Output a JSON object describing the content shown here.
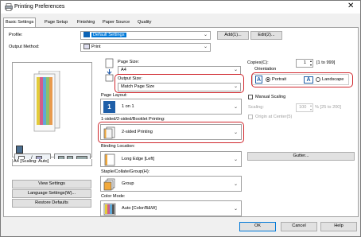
{
  "window": {
    "title": "Printing Preferences",
    "close_glyph": "✕"
  },
  "tabs": [
    "Basic Settings",
    "Page Setup",
    "Finishing",
    "Paper Source",
    "Quality"
  ],
  "profile": {
    "label": "Profile:",
    "value": "Default Settings",
    "add_btn": "Add(1)...",
    "edit_btn": "Edit(2)..."
  },
  "output_method": {
    "label": "Output Method:",
    "value": "Print"
  },
  "preview": {
    "caption": "A4 [Scaling: Auto]"
  },
  "left_buttons": {
    "view_settings": "View Settings",
    "language_settings": "Language Settings(W)...",
    "restore_defaults": "Restore Defaults"
  },
  "page_size": {
    "label": "Page Size:",
    "value": "A4"
  },
  "output_size": {
    "label": "Output Size:",
    "value": "Match Page Size"
  },
  "copies": {
    "label": "Copies(C):",
    "value": "1",
    "range": "[1 to 999]"
  },
  "orientation": {
    "label": "Orientation",
    "portrait": "Portrait",
    "landscape": "Landscape",
    "selected": "Portrait"
  },
  "manual_scaling": {
    "label": "Manual Scaling",
    "checked": false,
    "scaling_label": "Scaling:",
    "scaling_value": "100",
    "scaling_range": "% [25 to 200]",
    "origin_label": "Origin at Center(5)"
  },
  "page_layout": {
    "label": "Page Layout:",
    "value": "1 on 1",
    "icon_text": "1"
  },
  "sided": {
    "label": "1-sided/2-sided/Booklet Printing:",
    "value": "2-sided Printing"
  },
  "binding": {
    "label": "Binding Location:",
    "value": "Long Edge [Left]",
    "gutter_btn": "Gutter..."
  },
  "staple": {
    "label": "Staple/Collate/Group(H):",
    "value": "Group"
  },
  "color_mode": {
    "label": "Color Mode:",
    "value": "Auto [Color/B&W]"
  },
  "footer": {
    "ok": "OK",
    "cancel": "Cancel",
    "help": "Help"
  },
  "colors": {
    "highlight": "#d0282e",
    "selection": "#0078d7"
  }
}
